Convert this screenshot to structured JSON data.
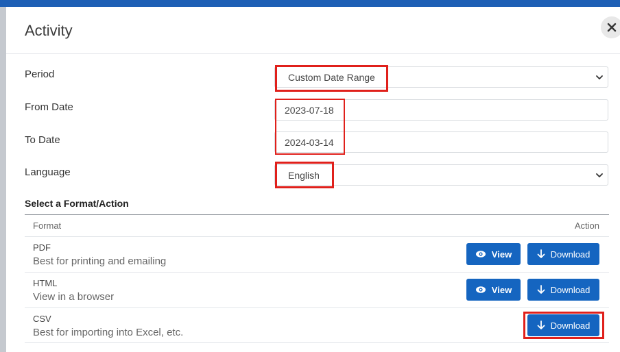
{
  "dialog": {
    "title": "Activity",
    "close_icon": "close-icon"
  },
  "form": {
    "period_label": "Period",
    "period_value": "Custom Date Range",
    "from_label": "From Date",
    "from_value": "2023-07-18",
    "to_label": "To Date",
    "to_value": "2024-03-14",
    "language_label": "Language",
    "language_value": "English"
  },
  "formats": {
    "heading": "Select a Format/Action",
    "column_format": "Format",
    "column_action": "Action",
    "view_label": "View",
    "download_label": "Download",
    "rows": [
      {
        "name": "PDF",
        "description": "Best for printing and emailing"
      },
      {
        "name": "HTML",
        "description": "View in a browser"
      },
      {
        "name": "CSV",
        "description": "Best for importing into Excel, etc."
      }
    ]
  },
  "colors": {
    "accent": "#1565c0",
    "top_bar": "#1e5fb5",
    "highlight": "#e0201b"
  }
}
